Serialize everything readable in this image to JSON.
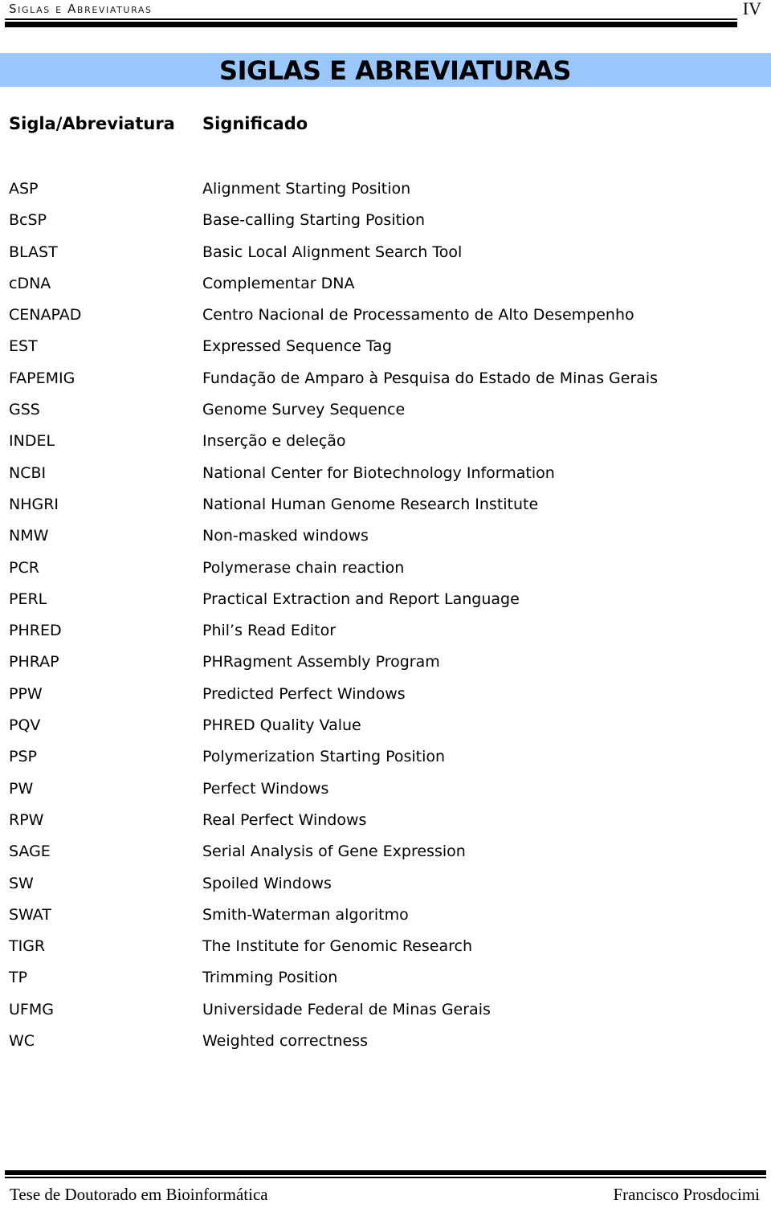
{
  "header": {
    "running_title": "Siglas e Abreviaturas",
    "page_number": "IV"
  },
  "title_band": {
    "title": "SIGLAS E ABREVIATURAS",
    "background_color": "#9AC8FD"
  },
  "table": {
    "columns": [
      "Sigla/Abreviatura",
      "Significado"
    ],
    "rows": [
      {
        "sigla": "ASP",
        "significado": "Alignment Starting Position"
      },
      {
        "sigla": "BcSP",
        "significado": "Base-calling Starting Position"
      },
      {
        "sigla": "BLAST",
        "significado": "Basic Local Alignment Search Tool"
      },
      {
        "sigla": "cDNA",
        "significado": "Complementar DNA"
      },
      {
        "sigla": "CENAPAD",
        "significado": "Centro Nacional de Processamento de Alto Desempenho"
      },
      {
        "sigla": "EST",
        "significado": "Expressed Sequence Tag"
      },
      {
        "sigla": "FAPEMIG",
        "significado": "Fundação de Amparo à Pesquisa do Estado de Minas Gerais"
      },
      {
        "sigla": "GSS",
        "significado": "Genome Survey Sequence"
      },
      {
        "sigla": "INDEL",
        "significado": "Inserção e deleção"
      },
      {
        "sigla": "NCBI",
        "significado": "National Center for Biotechnology Information"
      },
      {
        "sigla": "NHGRI",
        "significado": "National Human Genome Research Institute"
      },
      {
        "sigla": "NMW",
        "significado": "Non-masked windows"
      },
      {
        "sigla": "PCR",
        "significado": "Polymerase chain reaction"
      },
      {
        "sigla": "PERL",
        "significado": "Practical Extraction and Report Language"
      },
      {
        "sigla": "PHRED",
        "significado": "Phil’s Read Editor"
      },
      {
        "sigla": "PHRAP",
        "significado": "PHRagment Assembly Program"
      },
      {
        "sigla": "PPW",
        "significado": "Predicted Perfect Windows"
      },
      {
        "sigla": "PQV",
        "significado": "PHRED Quality Value"
      },
      {
        "sigla": "PSP",
        "significado": "Polymerization Starting Position"
      },
      {
        "sigla": "PW",
        "significado": "Perfect Windows"
      },
      {
        "sigla": "RPW",
        "significado": "Real Perfect Windows"
      },
      {
        "sigla": "SAGE",
        "significado": "Serial Analysis of Gene Expression"
      },
      {
        "sigla": "SW",
        "significado": "Spoiled Windows"
      },
      {
        "sigla": "SWAT",
        "significado": "Smith-Waterman algoritmo"
      },
      {
        "sigla": "TIGR",
        "significado": "The Institute for Genomic Research"
      },
      {
        "sigla": "TP",
        "significado": "Trimming Position"
      },
      {
        "sigla": "UFMG",
        "significado": "Universidade Federal de Minas Gerais"
      },
      {
        "sigla": "WC",
        "significado": "Weighted correctness"
      }
    ]
  },
  "footer": {
    "left": "Tese de Doutorado em Bioinformática",
    "right": "Francisco Prosdocimi"
  }
}
